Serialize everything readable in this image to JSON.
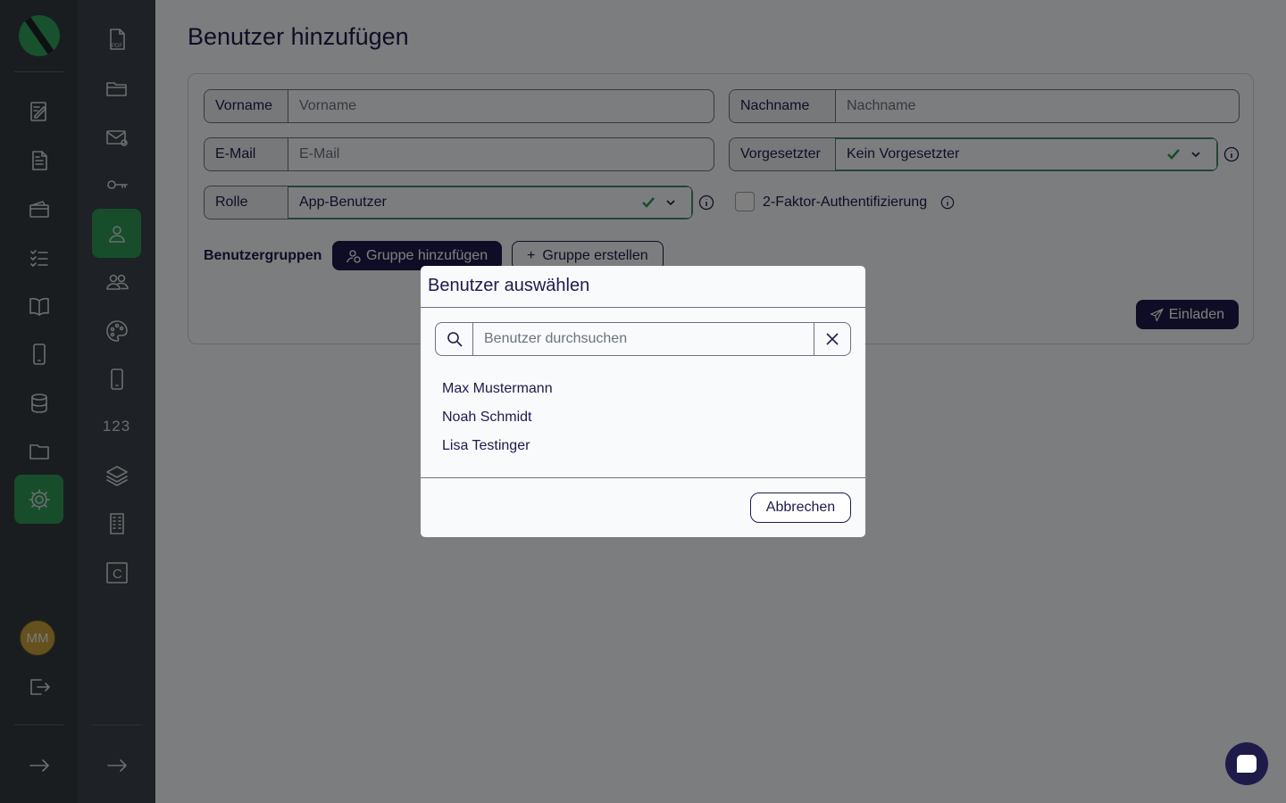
{
  "page": {
    "title": "Benutzer hinzufügen"
  },
  "sidebar": {
    "primary": [
      "logo",
      "edit-document-icon",
      "document-icon",
      "wallet-icon",
      "checklist-icon",
      "book-icon",
      "phone-icon",
      "database-icon",
      "folder-icon",
      "settings-icon"
    ],
    "secondary": [
      "pdf-icon",
      "folder-open-icon",
      "mail-icon",
      "key-icon",
      "user-icon",
      "users-icon",
      "palette-icon",
      "mobile-icon",
      "numbers-icon",
      "layers-icon",
      "building-icon",
      "c-box-icon"
    ],
    "numbers_label": "123",
    "c_label": "C",
    "avatar_initials": "MM"
  },
  "form": {
    "first_name": {
      "label": "Vorname",
      "placeholder": "Vorname"
    },
    "last_name": {
      "label": "Nachname",
      "placeholder": "Nachname"
    },
    "email": {
      "label": "E-Mail",
      "placeholder": "E-Mail"
    },
    "manager": {
      "label": "Vorgesetzter",
      "value": "Kein Vorgesetzter"
    },
    "role": {
      "label": "Rolle",
      "value": "App-Benutzer"
    },
    "two_factor": {
      "label": "2-Faktor-Authentifizierung",
      "checked": false
    },
    "groups": {
      "label": "Benutzergruppen",
      "add_button": "Gruppe hinzufügen",
      "create_button": "Gruppe erstellen"
    },
    "invite_button": "Einladen"
  },
  "modal": {
    "title": "Benutzer auswählen",
    "search_placeholder": "Benutzer durchsuchen",
    "users": [
      "Max Mustermann",
      "Noah Schmidt",
      "Lisa Testinger"
    ],
    "cancel_button": "Abbrechen"
  },
  "colors": {
    "brand_green": "#2e9a57",
    "primary_dark": "#1e1b4b",
    "rail_dark": "#343a40"
  }
}
